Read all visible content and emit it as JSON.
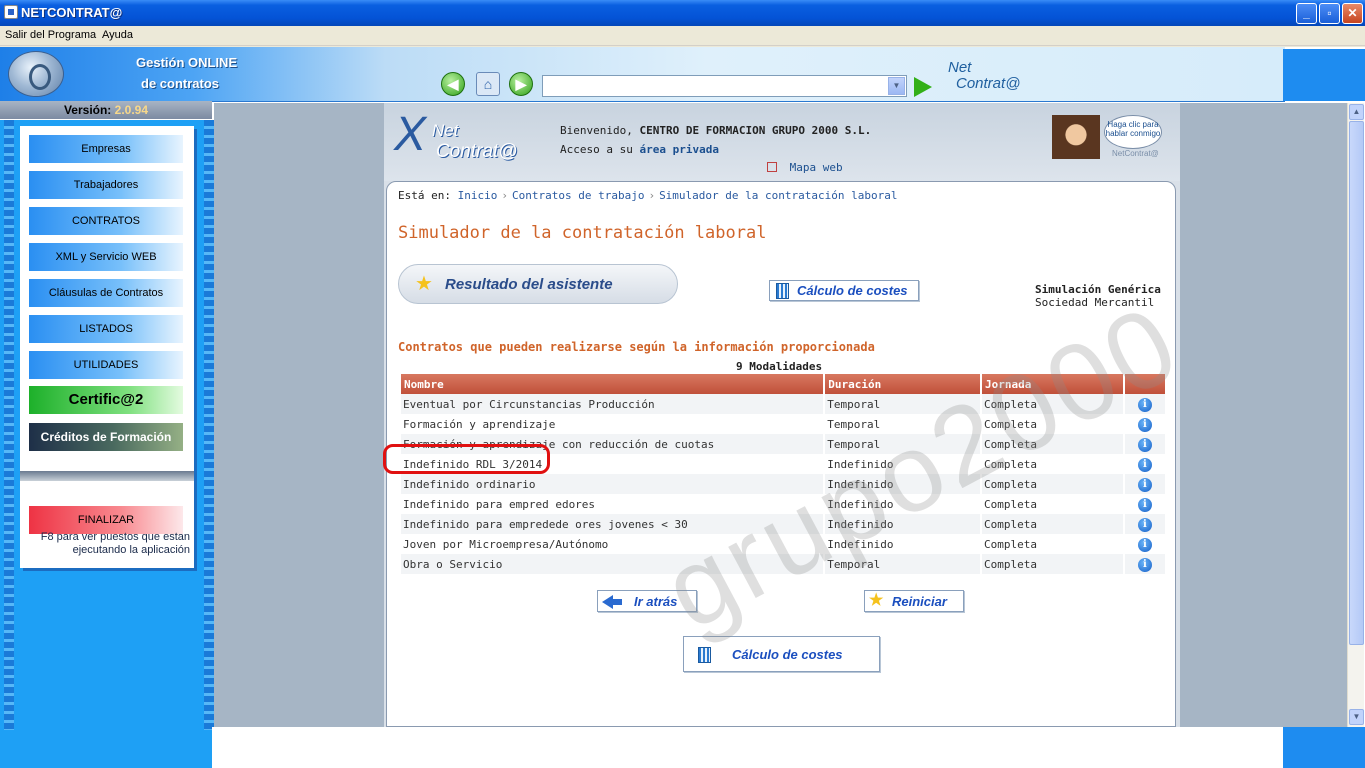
{
  "window": {
    "title": "NETCONTRAT@",
    "minimize": "_",
    "restore": "▫",
    "close": "✕"
  },
  "menubar": {
    "items": [
      "Salir del Programa",
      "Ayuda"
    ]
  },
  "header": {
    "title_line1": "Gestión ONLINE",
    "title_line2": "de contratos",
    "back_icon": "left-arrow-icon",
    "home_icon": "home-icon",
    "forward_icon": "right-arrow-icon",
    "address_value": "",
    "logo_text_1": "Net",
    "logo_text_2": "Contrat@"
  },
  "version": {
    "label": "Versión:",
    "value": "2.0.94"
  },
  "sidebar": {
    "items": [
      {
        "label": "Empresas"
      },
      {
        "label": "Trabajadores"
      },
      {
        "label": "CONTRATOS"
      },
      {
        "label": "XML y Servicio WEB"
      },
      {
        "label": "Cláusulas de Contratos"
      },
      {
        "label": "LISTADOS"
      },
      {
        "label": "UTILIDADES"
      },
      {
        "label": "Certific@2"
      },
      {
        "label": "Créditos de Formación"
      },
      {
        "label": "FINALIZAR"
      }
    ],
    "f8_line1": "F8  para ver puestos que estan",
    "f8_line2": "ejecutando la aplicación"
  },
  "page": {
    "logo_1": "Net",
    "logo_2": "Contrat@",
    "welcome_prefix": "Bienvenido,",
    "company": "CENTRO DE FORMACION GRUPO 2000 S.L.",
    "access_prefix": "Acceso a su",
    "access_link": "área privada",
    "map_link": "Mapa web",
    "assistant_bubble": "Haga clic para hablar conmigo",
    "assistant_brand": "NetContrat@",
    "breadcrumb": {
      "prefix": "Está en:",
      "items": [
        "Inicio",
        "Contratos de trabajo",
        "Simulador de la contratación laboral"
      ],
      "separator": "›"
    },
    "title": "Simulador de la contratación laboral",
    "result_button": "Resultado del asistente",
    "calc_button": "Cálculo de costes",
    "simulation_type": "Simulación Genérica",
    "company_type": "Sociedad Mercantil",
    "section_title": "Contratos que pueden realizarse según la información proporcionada",
    "modalities_count": "9 Modalidades",
    "table": {
      "headers": [
        "Nombre",
        "Duración",
        "Jornada",
        ""
      ],
      "rows": [
        {
          "name": "Eventual por Circunstancias Producción",
          "duration": "Temporal",
          "schedule": "Completa"
        },
        {
          "name": "Formación y aprendizaje",
          "duration": "Temporal",
          "schedule": "Completa"
        },
        {
          "name": "Formación y aprendizaje con reducción de cuotas",
          "duration": "Temporal",
          "schedule": "Completa"
        },
        {
          "name": "Indefinido RDL 3/2014",
          "duration": "Indefinido",
          "schedule": "Completa"
        },
        {
          "name": "Indefinido ordinario",
          "duration": "Indefinido",
          "schedule": "Completa"
        },
        {
          "name": "Indefinido para empred  edores",
          "duration": "Indefinido",
          "schedule": "Completa"
        },
        {
          "name": "Indefinido para empredede ores jovenes < 30",
          "duration": "Indefinido",
          "schedule": "Completa"
        },
        {
          "name": "Joven por Microempresa/Autónomo",
          "duration": "Indefinido",
          "schedule": "Completa"
        },
        {
          "name": "Obra o Servicio",
          "duration": "Temporal",
          "schedule": "Completa"
        }
      ],
      "info_icon_glyph": "i"
    },
    "back_button": "Ir atrás",
    "restart_button": "Reiniciar",
    "calc_button_bottom": "Cálculo de costes",
    "watermark": "grupo2000"
  },
  "colors": {
    "accent_orange": "#d0642a",
    "table_header": "#c0503a",
    "highlight": "#e01010",
    "sidebar_blue": "#1ea0f5"
  }
}
